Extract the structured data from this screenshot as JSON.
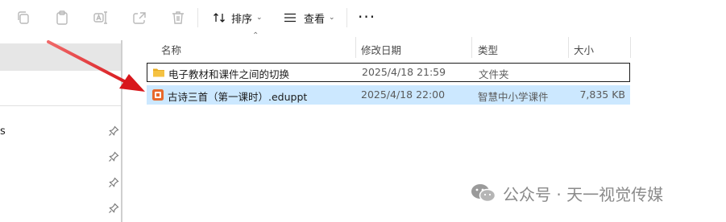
{
  "toolbar": {
    "sort_label": "排序",
    "view_label": "查看",
    "more_label": "···"
  },
  "nav": {
    "partial_item_text": "s"
  },
  "columns": {
    "name": "名称",
    "modified": "修改日期",
    "type": "类型",
    "size": "大小"
  },
  "files": [
    {
      "name": "电子教材和课件之间的切换",
      "modified": "2025/4/18 21:59",
      "type": "文件夹",
      "size": "",
      "icon": "folder-icon",
      "state": "focused"
    },
    {
      "name": "古诗三首（第一课时）.eduppt",
      "modified": "2025/4/18 22:00",
      "type": "智慧中小学课件",
      "size": "7,835 KB",
      "icon": "eduppt-file-icon",
      "state": "selected"
    }
  ],
  "watermark": {
    "text": "公众号 · 天一视觉传媒"
  },
  "colors": {
    "selection": "#cce8ff",
    "arrow": "#e0262b",
    "folder": "#f5c242",
    "file_icon": "#e8692c"
  }
}
